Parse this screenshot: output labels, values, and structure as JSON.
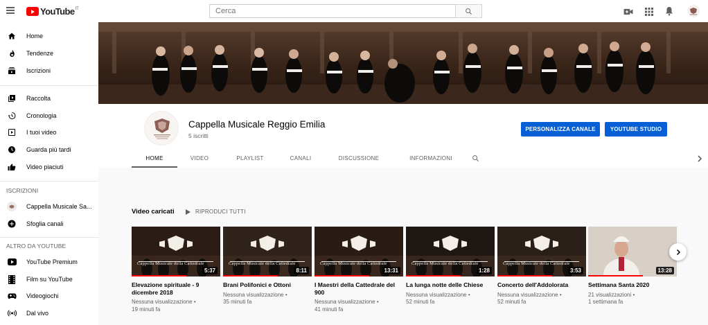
{
  "topbar": {
    "logo_text": "YouTube",
    "logo_region": "IT",
    "search_placeholder": "Cerca"
  },
  "sidebar": {
    "main": [
      {
        "label": "Home",
        "icon": "home-icon"
      },
      {
        "label": "Tendenze",
        "icon": "flame-icon"
      },
      {
        "label": "Iscrizioni",
        "icon": "subscriptions-icon"
      }
    ],
    "library": [
      {
        "label": "Raccolta",
        "icon": "library-icon"
      },
      {
        "label": "Cronologia",
        "icon": "history-icon"
      },
      {
        "label": "I tuoi video",
        "icon": "your-videos-icon"
      },
      {
        "label": "Guarda più tardi",
        "icon": "watch-later-icon"
      },
      {
        "label": "Video piaciuti",
        "icon": "thumb-up-icon"
      }
    ],
    "subscriptions_heading": "ISCRIZIONI",
    "subscriptions": [
      {
        "label": "Cappella Musicale Sa...",
        "icon": "channel-avatar-icon"
      },
      {
        "label": "Sfoglia canali",
        "icon": "add-circle-icon"
      }
    ],
    "more_heading": "ALTRO DA YOUTUBE",
    "more": [
      {
        "label": "YouTube Premium",
        "icon": "youtube-premium-icon"
      },
      {
        "label": "Film su YouTube",
        "icon": "film-icon"
      },
      {
        "label": "Videogiochi",
        "icon": "gamepad-icon"
      },
      {
        "label": "Dal vivo",
        "icon": "live-icon"
      }
    ]
  },
  "channel": {
    "name": "Cappella Musicale Reggio Emilia",
    "subscribers": "5 iscritti",
    "customize_label": "PERSONALIZZA CANALE",
    "studio_label": "YOUTUBE STUDIO",
    "tabs": [
      "HOME",
      "VIDEO",
      "PLAYLIST",
      "CANALI",
      "DISCUSSIONE",
      "INFORMAZIONI"
    ],
    "active_tab": "HOME"
  },
  "uploads": {
    "title": "Video caricati",
    "play_all": "RIPRODUCI TUTTI",
    "thumb_caption": "Cappella Musicale della Cattedrale",
    "videos": [
      {
        "title": "Elevazione spirituale - 9 dicembre 2018",
        "duration": "5:37",
        "views": "Nessuna visualizzazione",
        "age": "19 minuti fa"
      },
      {
        "title": "Brani Polifonici e Ottoni",
        "duration": "8:11",
        "views": "Nessuna visualizzazione",
        "age": "35 minuti fa"
      },
      {
        "title": "I Maestri della Cattedrale del 900",
        "duration": "13:31",
        "views": "Nessuna visualizzazione",
        "age": "41 minuti fa"
      },
      {
        "title": "La lunga notte delle Chiese",
        "duration": "1:28",
        "views": "Nessuna visualizzazione",
        "age": "52 minuti fa"
      },
      {
        "title": "Concerto dell'Addolorata",
        "duration": "3:53",
        "views": "Nessuna visualizzazione",
        "age": "52 minuti fa"
      },
      {
        "title": "Settimana Santa 2020",
        "duration": "13:28",
        "views": "21 visualizzazioni",
        "age": "1 settimana fa"
      }
    ]
  },
  "colors": {
    "brand_red": "#ff0000",
    "button_blue": "#065fd4"
  }
}
